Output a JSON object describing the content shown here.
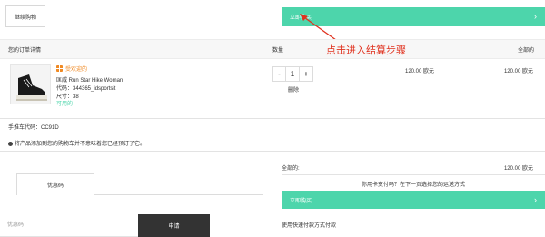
{
  "top": {
    "continue_label": "继续购物",
    "buy_now_label": "立即购买"
  },
  "annotation": {
    "text": "点击进入结算步骤"
  },
  "header": {
    "order_details": "您的订单详情",
    "quantity": "数量",
    "total": "全部的"
  },
  "item": {
    "gift_label": "受欢迎的",
    "name": "匡威 Run Star Hike Woman",
    "code": "代码：344365_idsportsit",
    "size": "尺寸：38",
    "availability": "可用的",
    "quantity": "1",
    "minus": "-",
    "plus": "+",
    "remove_label": "删除",
    "unit_price": "120.00 欧元",
    "line_total": "120.00 欧元"
  },
  "cart_code": "手推车代码：CC91D",
  "notice": "将产品添加到您的购物车并不意味着您已经预订了它。",
  "coupon": {
    "tab_label": "优惠码",
    "placeholder": "优惠码",
    "apply_label": "申请"
  },
  "summary": {
    "total_label": "全部的:",
    "total_value": "120.00 欧元",
    "shipping_question": "你用卡支付吗？在下一页选择您的运送方式",
    "buy_now_label": "立即购买",
    "express_pay": "使用快速付款方式付款"
  },
  "colors": {
    "accent": "#4dd5ab",
    "annotation": "#e0321f",
    "gift": "#f08a24",
    "dark_button": "#333333"
  },
  "icons": {
    "chevron": "chevron-right-icon",
    "gift": "gift-icon",
    "notice": "info-icon"
  }
}
